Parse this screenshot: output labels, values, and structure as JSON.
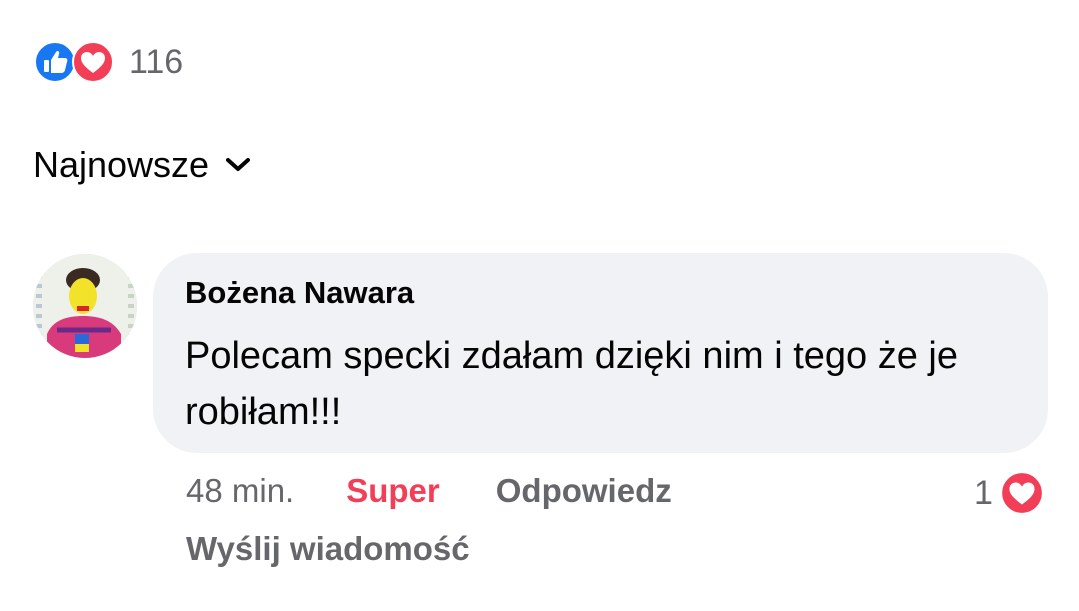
{
  "reactions": {
    "icons": [
      "like-icon",
      "love-icon"
    ],
    "count": "116",
    "colors": {
      "like": "#1877f2",
      "love": "#f33e58"
    }
  },
  "sort": {
    "label": "Najnowsze",
    "icon": "chevron-down-icon"
  },
  "comment": {
    "author": "Bożena Nawara",
    "text": "Polecam specki zdałam dzięki nim i tego że je robiłam!!!",
    "time": "48 min.",
    "reaction_label": "Super",
    "reply_label": "Odpowiedz",
    "message_label": "Wyślij wiadomość",
    "reaction_count": "1",
    "reaction_icon": "love-icon"
  }
}
